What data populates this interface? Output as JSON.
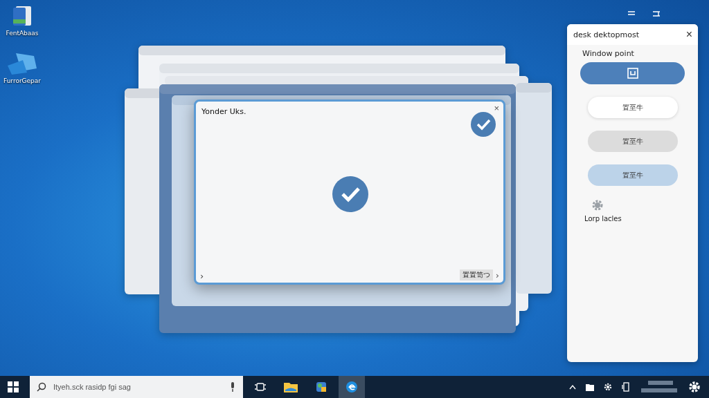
{
  "desktop_icons": [
    {
      "label": "FentAbaas",
      "kind": "binder"
    },
    {
      "label": "FurrorGepar",
      "kind": "shapes"
    }
  ],
  "dialog": {
    "title": "Yonder Uks.",
    "close": "×",
    "left_chevron": "›",
    "action": "置置笥つ",
    "action_chevron": "›"
  },
  "panel": {
    "title": "desk dektopmost",
    "close": "×",
    "section": "Window point",
    "buttons": [
      {
        "kind": "primary"
      },
      {
        "kind": "plain",
        "label": "置至牛"
      },
      {
        "kind": "muted",
        "label": "置至牛"
      },
      {
        "kind": "tinted",
        "label": "置至牛"
      }
    ],
    "settings_label": "Lorp lacles"
  },
  "taskbar": {
    "search": {
      "placeholder": "Ityeh.sck rasidp fgi sag"
    },
    "apps": [
      {
        "kind": "taskview",
        "selected": false
      },
      {
        "kind": "folder",
        "selected": false
      },
      {
        "kind": "store",
        "selected": false
      },
      {
        "kind": "browser",
        "selected": true
      }
    ]
  }
}
